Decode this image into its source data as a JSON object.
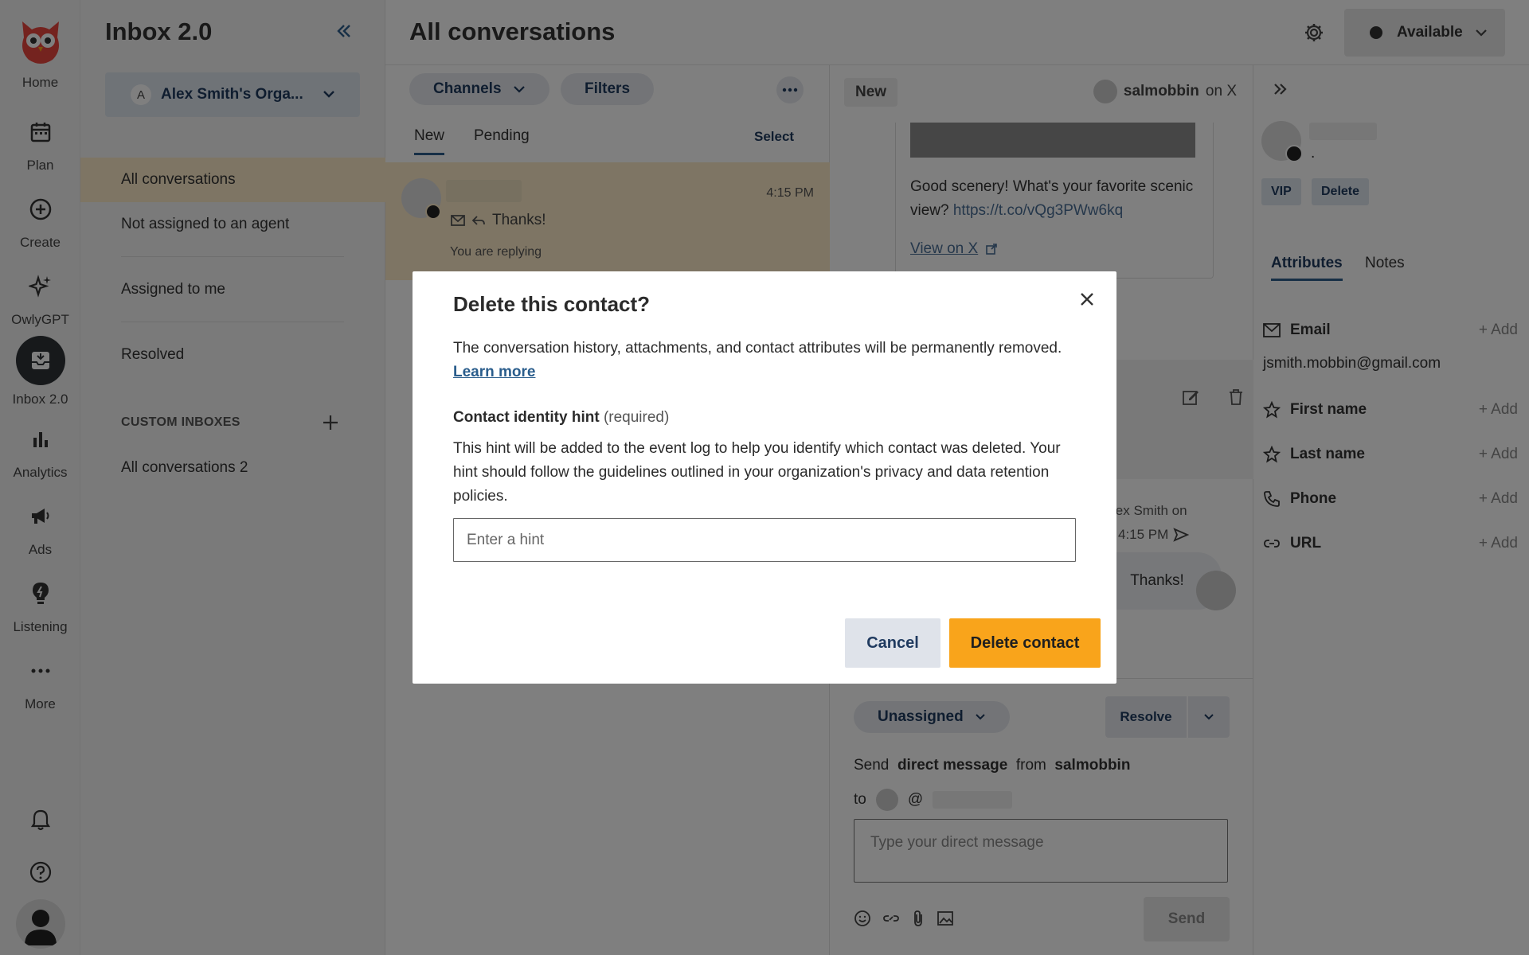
{
  "nav": {
    "items": [
      {
        "label": "Home",
        "icon": "owl-logo-icon"
      },
      {
        "label": "Plan",
        "icon": "calendar-icon"
      },
      {
        "label": "Create",
        "icon": "plus-circle-icon"
      },
      {
        "label": "OwlyGPT",
        "icon": "sparkle-icon"
      },
      {
        "label": "Inbox 2.0",
        "icon": "inbox-icon"
      },
      {
        "label": "Analytics",
        "icon": "bar-chart-icon"
      },
      {
        "label": "Ads",
        "icon": "megaphone-icon"
      },
      {
        "label": "Listening",
        "icon": "lightbulb-icon"
      },
      {
        "label": "More",
        "icon": "more-icon"
      }
    ]
  },
  "sidebar": {
    "title": "Inbox 2.0",
    "org_initial": "A",
    "org_name": "Alex Smith's Orga...",
    "links": [
      "All conversations",
      "Not assigned to an agent",
      "Assigned to me",
      "Resolved"
    ],
    "section_title": "CUSTOM INBOXES",
    "custom_links": [
      "All conversations 2"
    ]
  },
  "header": {
    "title": "All conversations",
    "status": "Available"
  },
  "list": {
    "channels_label": "Channels",
    "filters_label": "Filters",
    "tabs": [
      "New",
      "Pending"
    ],
    "select_label": "Select",
    "conversation": {
      "time": "4:15 PM",
      "message": "Thanks!",
      "status": "You are replying"
    }
  },
  "thread": {
    "new_label": "New",
    "user": "salmobbin",
    "network_suffix": "on X",
    "post_text": "Good scenery! What's your favorite scenic view?",
    "post_link": "https://t.co/vQg3PWw6kq",
    "view_link": "View on X",
    "author_fragment": "lex Smith on",
    "reply_time": "4:15 PM",
    "reply_text": "Thanks!",
    "assignee_label": "Unassigned",
    "resolve_label": "Resolve",
    "send_word": "Send",
    "send_type": "direct message",
    "from_word": "from",
    "from_account": "salmobbin",
    "to_word": "to",
    "at_sign": "@",
    "dm_placeholder": "Type your direct message",
    "send_button": "Send"
  },
  "contact": {
    "dot": ".",
    "vip_label": "VIP",
    "delete_label": "Delete",
    "tabs": [
      "Attributes",
      "Notes"
    ],
    "attributes": [
      {
        "label": "Email",
        "icon": "mail-icon"
      },
      {
        "label": "First name",
        "icon": "star-icon"
      },
      {
        "label": "Last name",
        "icon": "star-icon"
      },
      {
        "label": "Phone",
        "icon": "phone-icon"
      },
      {
        "label": "URL",
        "icon": "link-icon"
      }
    ],
    "add_label": "+ Add",
    "email_value": "jsmith.mobbin@gmail.com"
  },
  "modal": {
    "title": "Delete this contact?",
    "description": "The conversation history, attachments, and contact attributes will be permanently removed.",
    "learn_more": "Learn more",
    "field_label": "Contact identity hint",
    "field_required": "(required)",
    "help_text": "This hint will be added to the event log to help you identify which contact was deleted. Your hint should follow the guidelines outlined in your organization's privacy and data retention policies.",
    "placeholder": "Enter a hint",
    "cancel_label": "Cancel",
    "delete_label": "Delete contact"
  },
  "colors": {
    "accent": "#f9a41b",
    "brand_navy": "#1f3a5f",
    "selected_row": "#fcebc9"
  }
}
